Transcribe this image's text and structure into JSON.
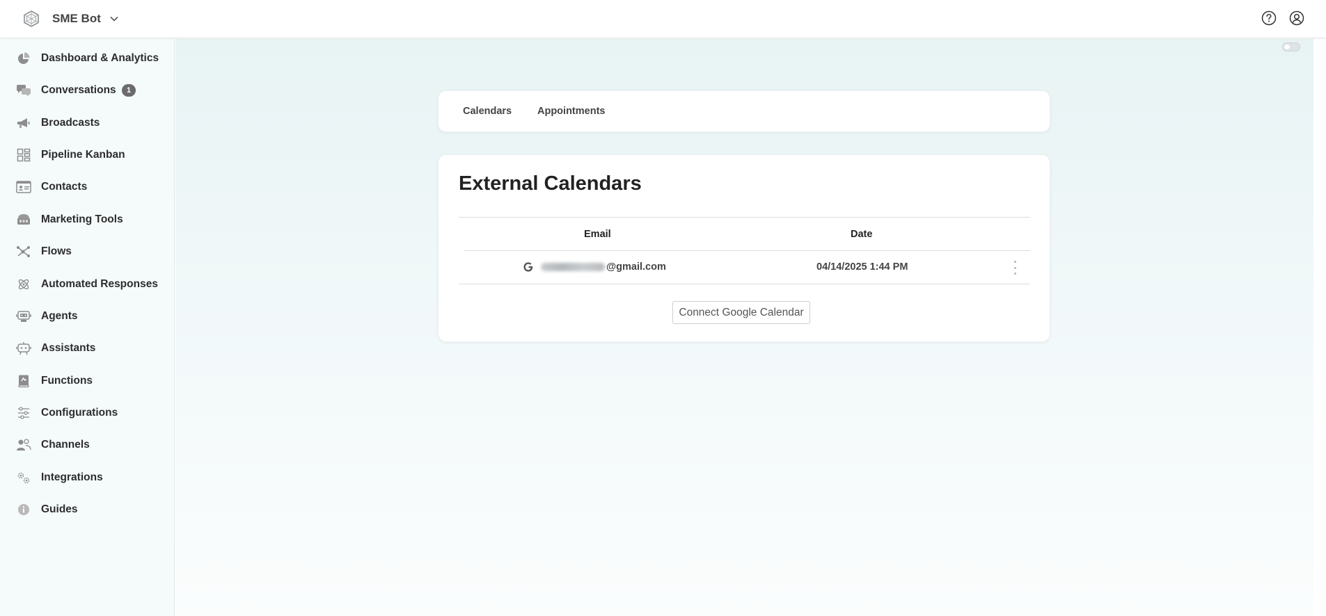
{
  "app": {
    "name": "SME Bot"
  },
  "topbar": {
    "help_icon": "question-circle-icon",
    "account_icon": "user-circle-icon"
  },
  "sidebar": {
    "items": [
      {
        "label": "Dashboard & Analytics",
        "icon": "pie-chart-icon"
      },
      {
        "label": "Conversations",
        "icon": "chat-bubbles-icon",
        "badge": "1"
      },
      {
        "label": "Broadcasts",
        "icon": "megaphone-icon"
      },
      {
        "label": "Pipeline Kanban",
        "icon": "kanban-icon"
      },
      {
        "label": "Contacts",
        "icon": "contact-card-icon"
      },
      {
        "label": "Marketing Tools",
        "icon": "toolbox-icon"
      },
      {
        "label": "Flows",
        "icon": "flow-icon"
      },
      {
        "label": "Automated Responses",
        "icon": "atom-icon"
      },
      {
        "label": "Agents",
        "icon": "agent-icon"
      },
      {
        "label": "Assistants",
        "icon": "robot-icon"
      },
      {
        "label": "Functions",
        "icon": "function-book-icon"
      },
      {
        "label": "Configurations",
        "icon": "sliders-icon"
      },
      {
        "label": "Channels",
        "icon": "users-icon"
      },
      {
        "label": "Integrations",
        "icon": "gears-icon"
      },
      {
        "label": "Guides",
        "icon": "info-icon"
      }
    ]
  },
  "tabs": [
    {
      "label": "Calendars"
    },
    {
      "label": "Appointments"
    }
  ],
  "external_calendars": {
    "title": "External Calendars",
    "columns": [
      "Email",
      "Date"
    ],
    "rows": [
      {
        "email_domain": "@gmail.com",
        "date": "04/14/2025 1:44 PM",
        "provider_icon": "google-icon"
      }
    ],
    "connect_button": "Connect Google Calendar"
  }
}
